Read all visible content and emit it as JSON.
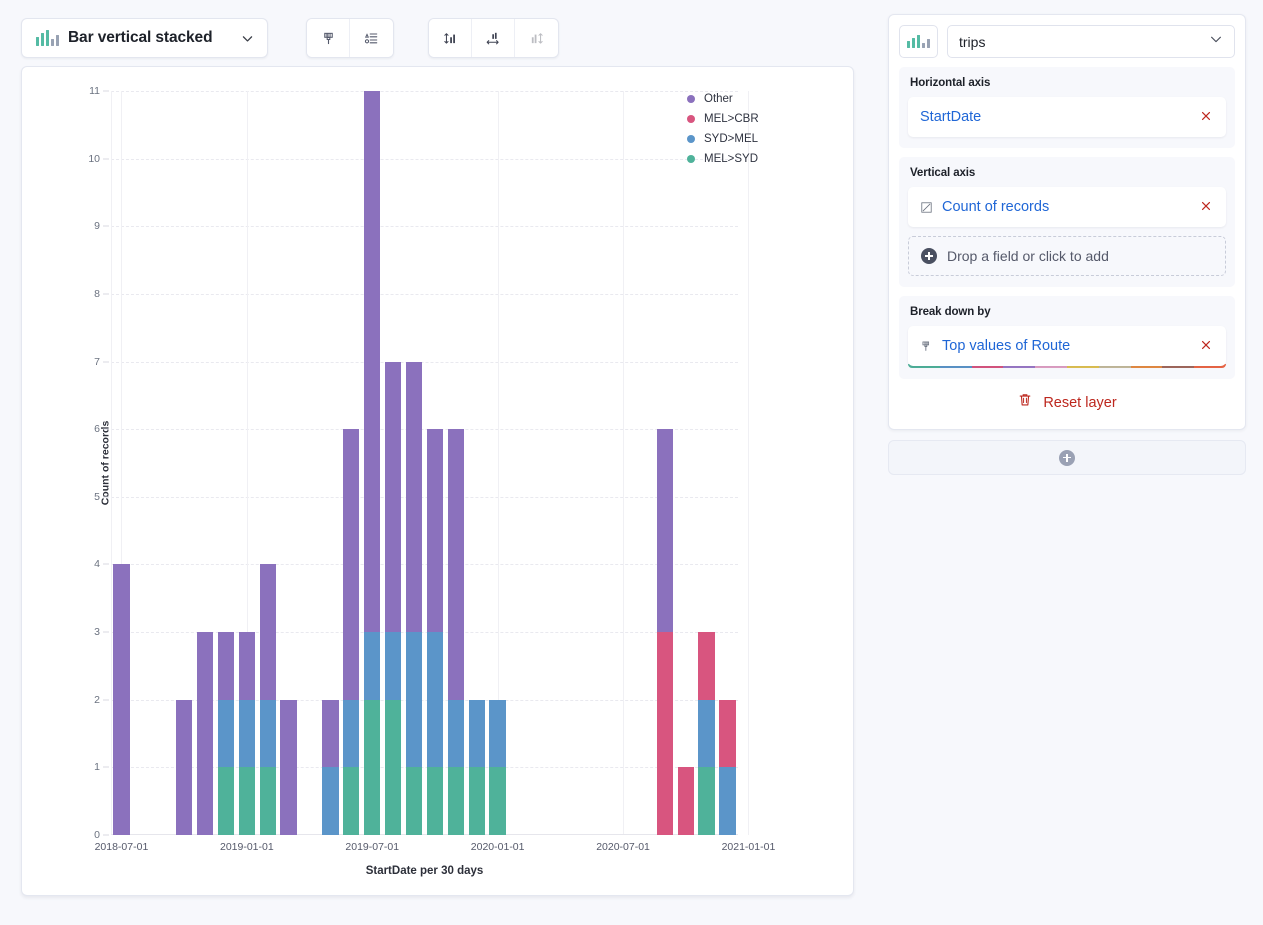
{
  "toolbar": {
    "chart_type_label": "Bar vertical stacked",
    "chart_type_icon": "bar-vertical-stacked-icon",
    "chevron_icon": "chevron-down-icon",
    "buttons": [
      {
        "name": "brush-icon",
        "title": "Appearance",
        "disabled": false
      },
      {
        "name": "legend-settings-icon",
        "title": "Legend",
        "disabled": false
      },
      {
        "name": "vertical-axis-settings-icon",
        "title": "Left axis",
        "disabled": false
      },
      {
        "name": "horizontal-axis-settings-icon",
        "title": "Bottom axis",
        "disabled": false
      },
      {
        "name": "right-axis-settings-icon",
        "title": "Right axis",
        "disabled": true
      }
    ]
  },
  "chart_data": {
    "type": "bar",
    "stacked": true,
    "title": "",
    "xlabel": "StartDate per 30 days",
    "ylabel": "Count of records",
    "ylim": [
      0,
      11
    ],
    "yticks": [
      0,
      1,
      2,
      3,
      4,
      5,
      6,
      7,
      8,
      9,
      10,
      11
    ],
    "xticks": [
      "2018-07-01",
      "2019-01-01",
      "2019-07-01",
      "2020-01-01",
      "2020-07-01",
      "2021-01-01"
    ],
    "grid": "horizontal-dashed-and-vertical",
    "legend_position": "right",
    "legend": [
      "Other",
      "MEL>CBR",
      "SYD>MEL",
      "MEL>SYD"
    ],
    "colors": {
      "Other": "#8b71bd",
      "MEL>CBR": "#d8557f",
      "SYD>MEL": "#5b95c9",
      "MEL>SYD": "#4fb29a"
    },
    "series": [
      {
        "name": "MEL>SYD",
        "color": "#4fb29a",
        "values": [
          0,
          0,
          0,
          0,
          0,
          1,
          1,
          1,
          0,
          0,
          0,
          1,
          2,
          2,
          1,
          1,
          1,
          1,
          1,
          0,
          0,
          0,
          0,
          0,
          0,
          0,
          0,
          0,
          1,
          0
        ]
      },
      {
        "name": "SYD>MEL",
        "color": "#5b95c9",
        "values": [
          0,
          0,
          0,
          0,
          0,
          1,
          1,
          1,
          0,
          0,
          1,
          1,
          1,
          1,
          2,
          2,
          1,
          1,
          1,
          0,
          0,
          0,
          0,
          0,
          0,
          0,
          0,
          0,
          1,
          1
        ]
      },
      {
        "name": "MEL>CBR",
        "color": "#d8557f",
        "values": [
          0,
          0,
          0,
          0,
          0,
          0,
          0,
          0,
          0,
          0,
          0,
          0,
          0,
          0,
          0,
          0,
          0,
          0,
          0,
          0,
          0,
          0,
          0,
          0,
          0,
          0,
          3,
          1,
          1,
          1
        ]
      },
      {
        "name": "Other",
        "color": "#8b71bd",
        "values": [
          4,
          0,
          0,
          2,
          3,
          1,
          1,
          2,
          2,
          0,
          1,
          4,
          8,
          4,
          4,
          3,
          4,
          0,
          0,
          0,
          0,
          0,
          0,
          0,
          0,
          0,
          3,
          0,
          0,
          0
        ]
      }
    ],
    "bar_totals": [
      4,
      0,
      0,
      2,
      3,
      3,
      3,
      4,
      2,
      0,
      2,
      6,
      11,
      7,
      7,
      6,
      7,
      2,
      2,
      0,
      0,
      0,
      0,
      0,
      0,
      0,
      6,
      1,
      3,
      2
    ]
  },
  "right_panel": {
    "source_icon": "data-source-icon",
    "source_value": "trips",
    "source_chevron_icon": "chevron-down-icon",
    "horizontal_axis": {
      "title": "Horizontal axis",
      "field": "StartDate",
      "remove_icon": "close-icon"
    },
    "vertical_axis": {
      "title": "Vertical axis",
      "field": "Count of records",
      "field_icon": "formula-icon",
      "remove_icon": "close-icon",
      "drop_zone": "Drop a field or click to add",
      "drop_zone_icon": "plus-circle-icon"
    },
    "break_down_by": {
      "title": "Break down by",
      "field": "Top values of Route",
      "field_icon": "palette-icon",
      "remove_icon": "close-icon",
      "palette": [
        "#4fb29a",
        "#5b95c9",
        "#d8557f",
        "#9a79c7",
        "#dfa0c4",
        "#e0c252",
        "#c5bb9c",
        "#e58c42",
        "#a1685c",
        "#ec6645"
      ]
    },
    "reset_layer": {
      "label": "Reset layer",
      "icon": "trash-icon"
    },
    "add_layer_icon": "plus-circle-icon"
  }
}
